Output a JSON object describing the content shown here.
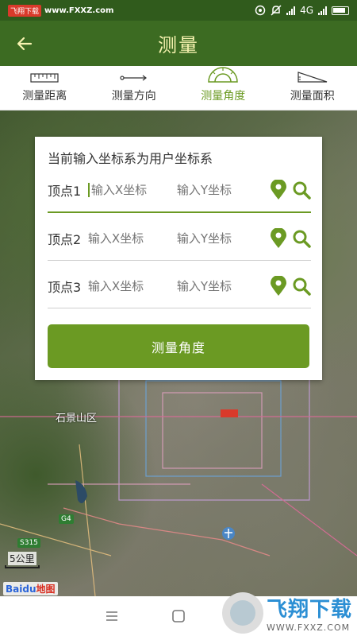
{
  "status_bar": {
    "watermark_label": "飞翔下载",
    "url": "www.FXXZ.com",
    "network": "4G"
  },
  "header": {
    "title": "测量"
  },
  "tabs": [
    {
      "label": "测量距离",
      "icon": "ruler-icon"
    },
    {
      "label": "测量方向",
      "icon": "direction-arrow-icon"
    },
    {
      "label": "测量角度",
      "icon": "protractor-icon",
      "active": true
    },
    {
      "label": "测量面积",
      "icon": "area-triangle-icon"
    }
  ],
  "card": {
    "title": "当前输入坐标系为用户坐标系",
    "vertices": [
      {
        "label": "顶点1",
        "x_placeholder": "输入X坐标",
        "y_placeholder": "输入Y坐标"
      },
      {
        "label": "顶点2",
        "x_placeholder": "输入X坐标",
        "y_placeholder": "输入Y坐标"
      },
      {
        "label": "顶点3",
        "x_placeholder": "输入X坐标",
        "y_placeholder": "输入Y坐标"
      }
    ],
    "button_label": "测量角度"
  },
  "map": {
    "district_label": "石景山区",
    "road_shields": [
      "G4",
      "S315"
    ],
    "scale_label": "5公里",
    "logo_text": "Baidu",
    "logo_suffix": "地图"
  },
  "watermark": {
    "title": "飞翔下载",
    "url": "WWW.FXXZ.COM"
  },
  "colors": {
    "accent": "#6b9a23",
    "header": "#3c6b22",
    "status_bar": "#305b1c",
    "title_text": "#f7f3b0"
  }
}
